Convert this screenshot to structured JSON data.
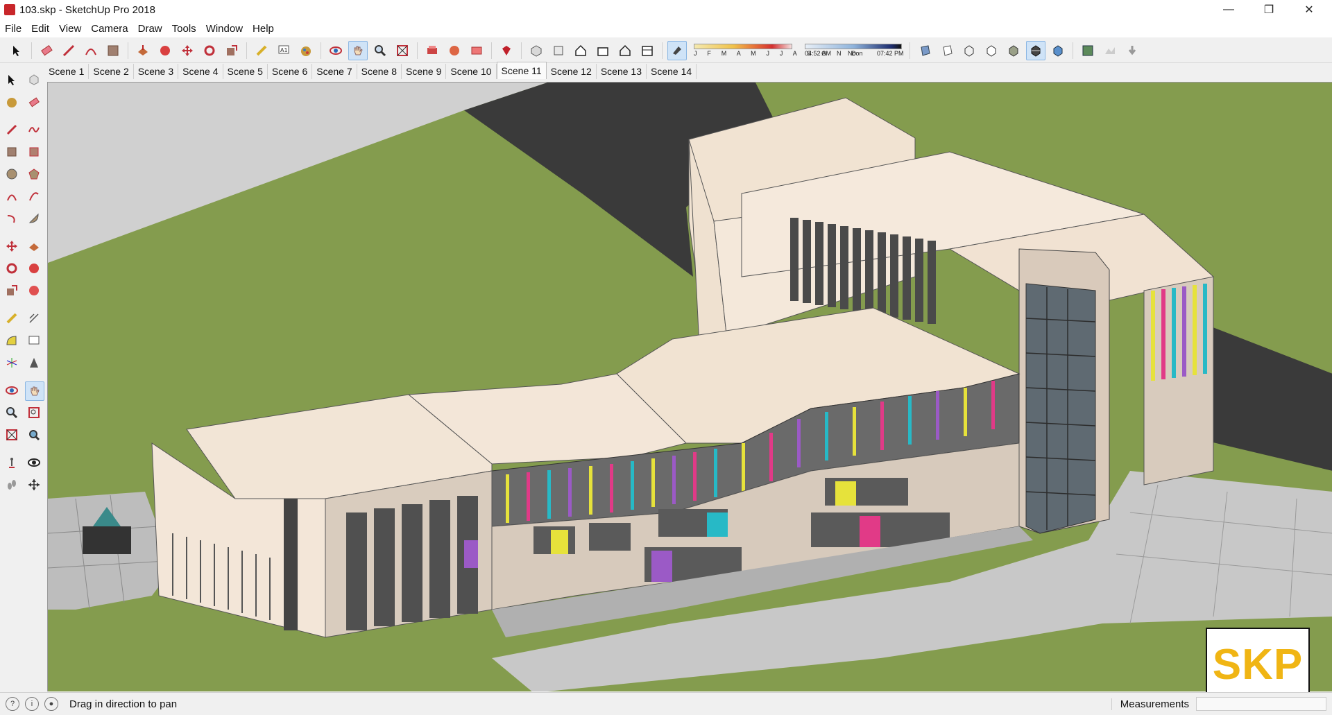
{
  "window": {
    "title": "103.skp - SketchUp Pro 2018"
  },
  "menu": [
    "File",
    "Edit",
    "View",
    "Camera",
    "Draw",
    "Tools",
    "Window",
    "Help"
  ],
  "shadow": {
    "months_letters": "J F M A M J J A S O N D",
    "time_start": "04:52 AM",
    "time_mid": "Noon",
    "time_end": "07:42 PM"
  },
  "scenes": [
    "Scene 1",
    "Scene 2",
    "Scene 3",
    "Scene 4",
    "Scene 5",
    "Scene 6",
    "Scene 7",
    "Scene 8",
    "Scene 9",
    "Scene 10",
    "Scene 11",
    "Scene 12",
    "Scene 13",
    "Scene 14"
  ],
  "active_scene": "Scene 11",
  "status": {
    "hint": "Drag in direction to pan",
    "measurements_label": "Measurements",
    "measurements_value": ""
  },
  "watermark": "SKP",
  "colors": {
    "grass": "#849c4e",
    "ground_gray": "#d0d0d0",
    "road": "#3a3a3a",
    "facade": "#f3e6d8",
    "accent_pink": "#e13a87",
    "accent_yellow": "#e6e23b",
    "accent_cyan": "#27b9c6",
    "accent_purple": "#9b5ac6",
    "skp_yellow": "#f0b514"
  }
}
